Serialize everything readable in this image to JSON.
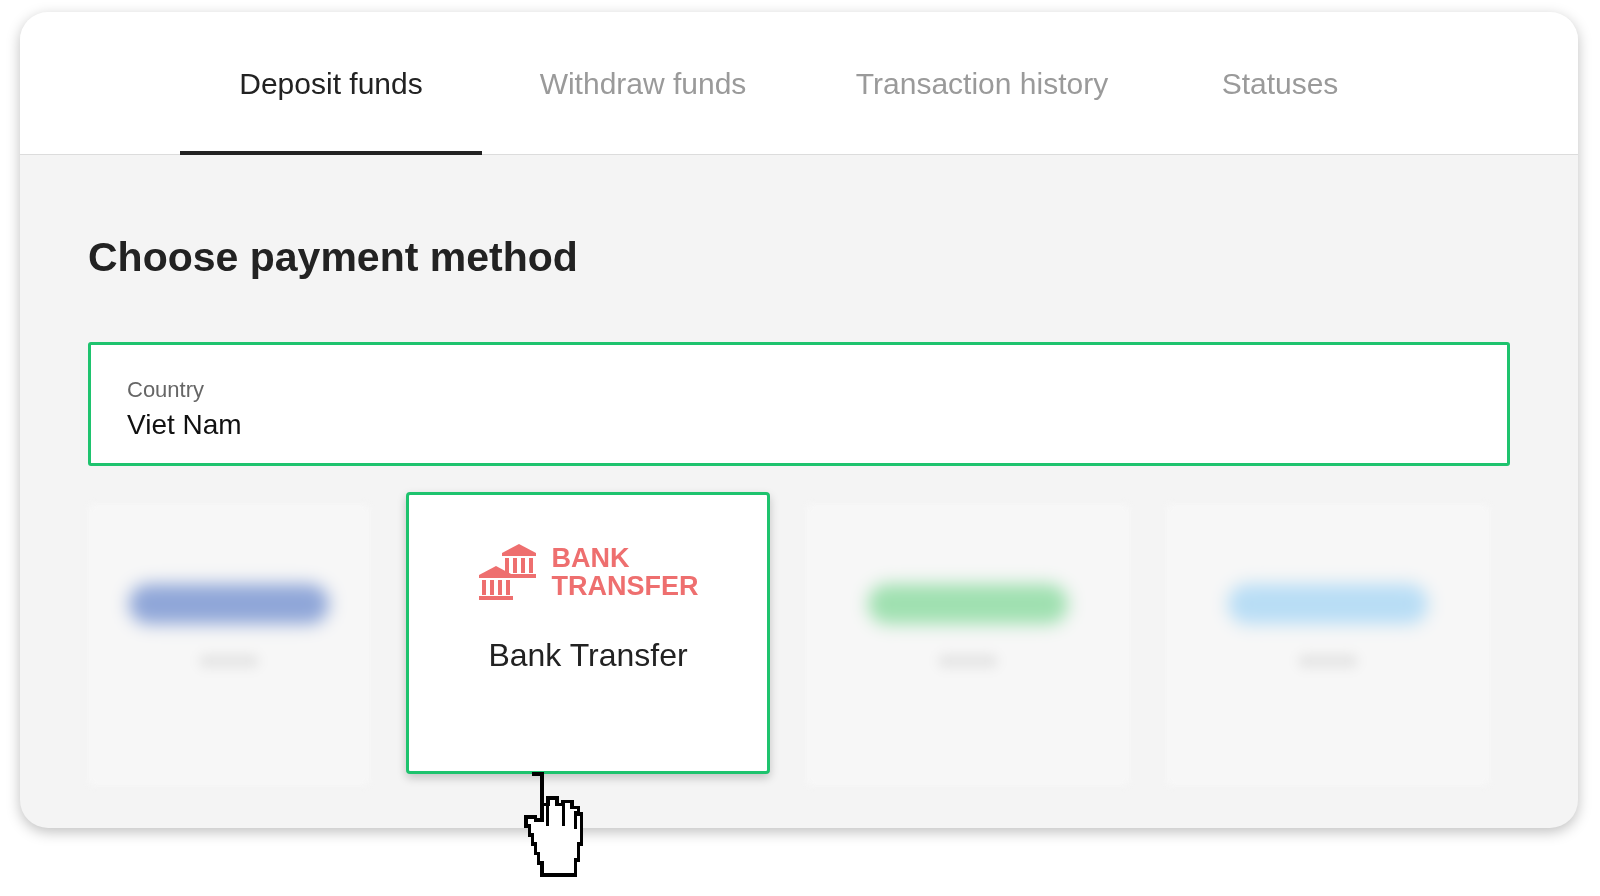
{
  "tabs": [
    {
      "label": "Deposit funds",
      "selected": true
    },
    {
      "label": "Withdraw funds",
      "selected": false
    },
    {
      "label": "Transaction history",
      "selected": false
    },
    {
      "label": "Statuses",
      "selected": false
    }
  ],
  "heading": "Choose payment method",
  "country_field": {
    "label": "Country",
    "value": "Viet Nam"
  },
  "methods": [
    {
      "kind": "blurred",
      "color": "#8fa6d8",
      "selected": false
    },
    {
      "kind": "logo",
      "logo_text": [
        "BANK",
        "TRANSFER"
      ],
      "label": "Bank Transfer",
      "selected": true
    },
    {
      "kind": "blurred",
      "color": "#9fe0b0",
      "selected": false
    },
    {
      "kind": "blurred",
      "color": "#b8ddf5",
      "selected": false
    }
  ]
}
